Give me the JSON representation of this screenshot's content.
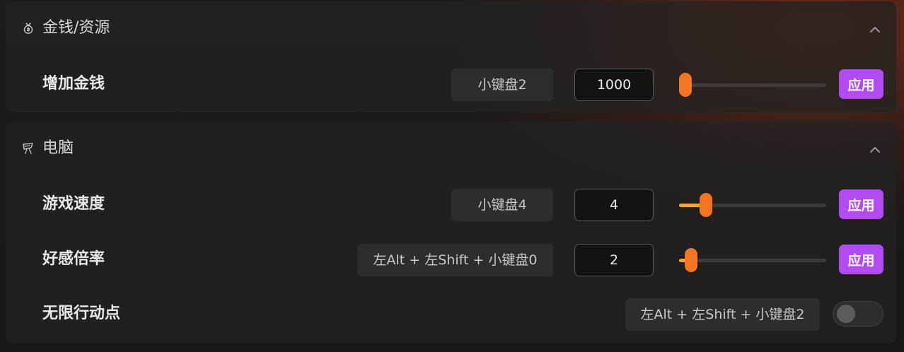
{
  "sections": [
    {
      "title": "金钱/资源",
      "icon": "money-bag-icon",
      "expanded": true,
      "rows": [
        {
          "label": "增加金钱",
          "hotkey": "小键盘2",
          "value": "1000",
          "slider_fraction": 0.0,
          "apply_label": "应用"
        }
      ]
    },
    {
      "title": "电脑",
      "icon": "computer-icon",
      "expanded": true,
      "rows": [
        {
          "label": "游戏速度",
          "hotkey": "小键盘4",
          "value": "4",
          "slider_fraction": 0.15,
          "apply_label": "应用"
        },
        {
          "label": "好感倍率",
          "hotkey": "左Alt + 左Shift + 小键盘0",
          "value": "2",
          "slider_fraction": 0.04,
          "apply_label": "应用"
        },
        {
          "label": "无限行动点",
          "hotkey": "左Alt + 左Shift + 小键盘2",
          "toggle_on": false
        }
      ]
    }
  ],
  "colors": {
    "accent_purple": "#b24cf2",
    "slider_orange": "#f37522",
    "slider_fill": "#f4a63c"
  }
}
